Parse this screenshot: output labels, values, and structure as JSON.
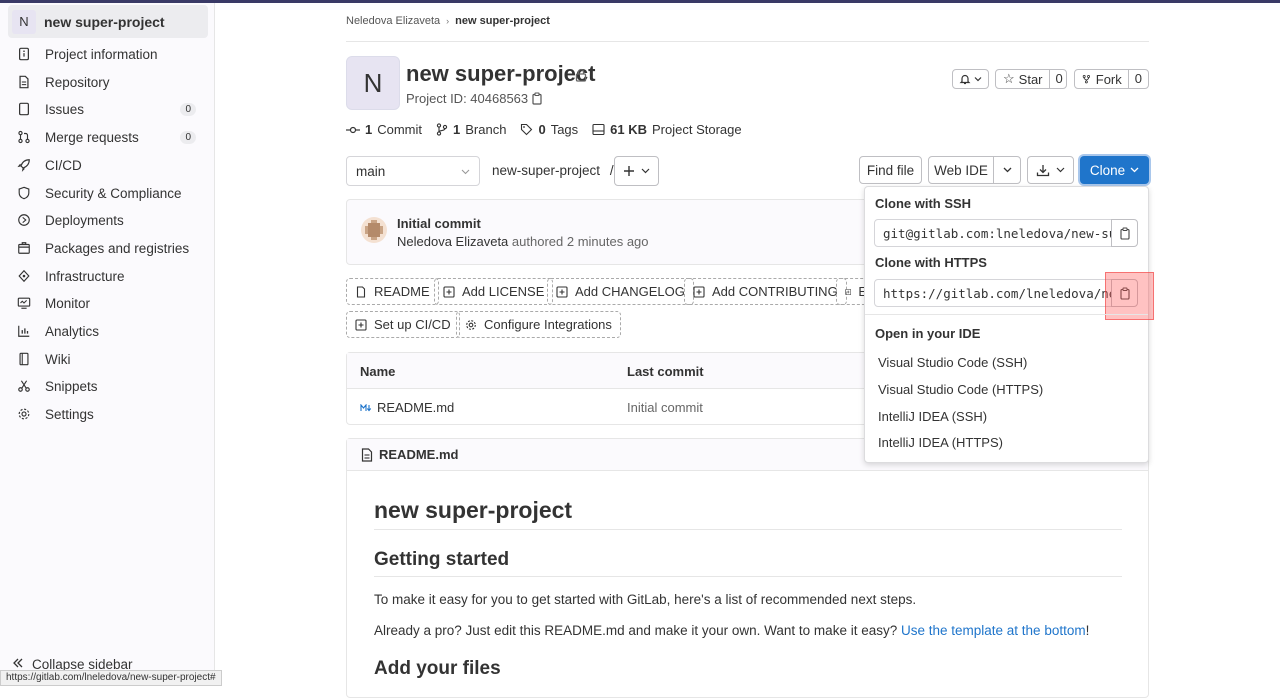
{
  "sidebar": {
    "avatar_letter": "N",
    "title": "new super-project",
    "items": [
      {
        "label": "Project information",
        "icon": "info-icon"
      },
      {
        "label": "Repository",
        "icon": "document-icon"
      },
      {
        "label": "Issues",
        "icon": "issues-icon",
        "badge": "0"
      },
      {
        "label": "Merge requests",
        "icon": "merge-request-icon",
        "badge": "0"
      },
      {
        "label": "CI/CD",
        "icon": "rocket-icon"
      },
      {
        "label": "Security & Compliance",
        "icon": "shield-icon"
      },
      {
        "label": "Deployments",
        "icon": "deployments-icon"
      },
      {
        "label": "Packages and registries",
        "icon": "package-icon"
      },
      {
        "label": "Infrastructure",
        "icon": "cloud-icon"
      },
      {
        "label": "Monitor",
        "icon": "monitor-icon"
      },
      {
        "label": "Analytics",
        "icon": "chart-icon"
      },
      {
        "label": "Wiki",
        "icon": "book-icon"
      },
      {
        "label": "Snippets",
        "icon": "snippet-icon"
      },
      {
        "label": "Settings",
        "icon": "gear-icon"
      }
    ],
    "collapse_label": "Collapse sidebar"
  },
  "status_url": "https://gitlab.com/lneledova/new-super-project#",
  "breadcrumb": {
    "user": "Neledova Elizaveta",
    "project": "new super-project"
  },
  "project": {
    "avatar_letter": "N",
    "title": "new super-project",
    "id_text": "Project ID: 40468563"
  },
  "header_buttons": {
    "star_label": "Star",
    "star_count": "0",
    "fork_label": "Fork",
    "fork_count": "0"
  },
  "stats": {
    "commits_num": "1",
    "commits_label": "Commit",
    "branches_num": "1",
    "branches_label": "Branch",
    "tags_num": "0",
    "tags_label": "Tags",
    "storage_num": "61 KB",
    "storage_label": "Project Storage"
  },
  "repo_bar": {
    "branch": "main",
    "path": "new-super-project",
    "path_sep": "/",
    "find_file": "Find file",
    "web_ide": "Web IDE",
    "clone": "Clone"
  },
  "commit": {
    "title": "Initial commit",
    "author": "Neledova Elizaveta",
    "meta": "authored 2 minutes ago"
  },
  "quick_actions": {
    "readme": "README",
    "license": "Add LICENSE",
    "changelog": "Add CHANGELOG",
    "contributing": "Add CONTRIBUTING",
    "kube_initial": "E",
    "cicd": "Set up CI/CD",
    "integrations": "Configure Integrations"
  },
  "file_table": {
    "col_name": "Name",
    "col_commit": "Last commit",
    "rows": [
      {
        "name": "README.md",
        "commit": "Initial commit"
      }
    ]
  },
  "readme": {
    "filename": "README.md",
    "h1": "new super-project",
    "h2_started": "Getting started",
    "p1": "To make it easy for you to get started with GitLab, here's a list of recommended next steps.",
    "p2_pre": "Already a pro? Just edit this README.md and make it your own. Want to make it easy? ",
    "p2_link": "Use the template at the bottom",
    "p2_post": "!",
    "h2_files": "Add your files"
  },
  "clone_dropdown": {
    "ssh_title": "Clone with SSH",
    "ssh_url": "git@gitlab.com:lneledova/new-super-project.git",
    "https_title": "Clone with HTTPS",
    "https_url": "https://gitlab.com/lneledova/new-super-project.git",
    "ide_title": "Open in your IDE",
    "ide_items": [
      "Visual Studio Code (SSH)",
      "Visual Studio Code (HTTPS)",
      "IntelliJ IDEA (SSH)",
      "IntelliJ IDEA (HTTPS)"
    ]
  }
}
